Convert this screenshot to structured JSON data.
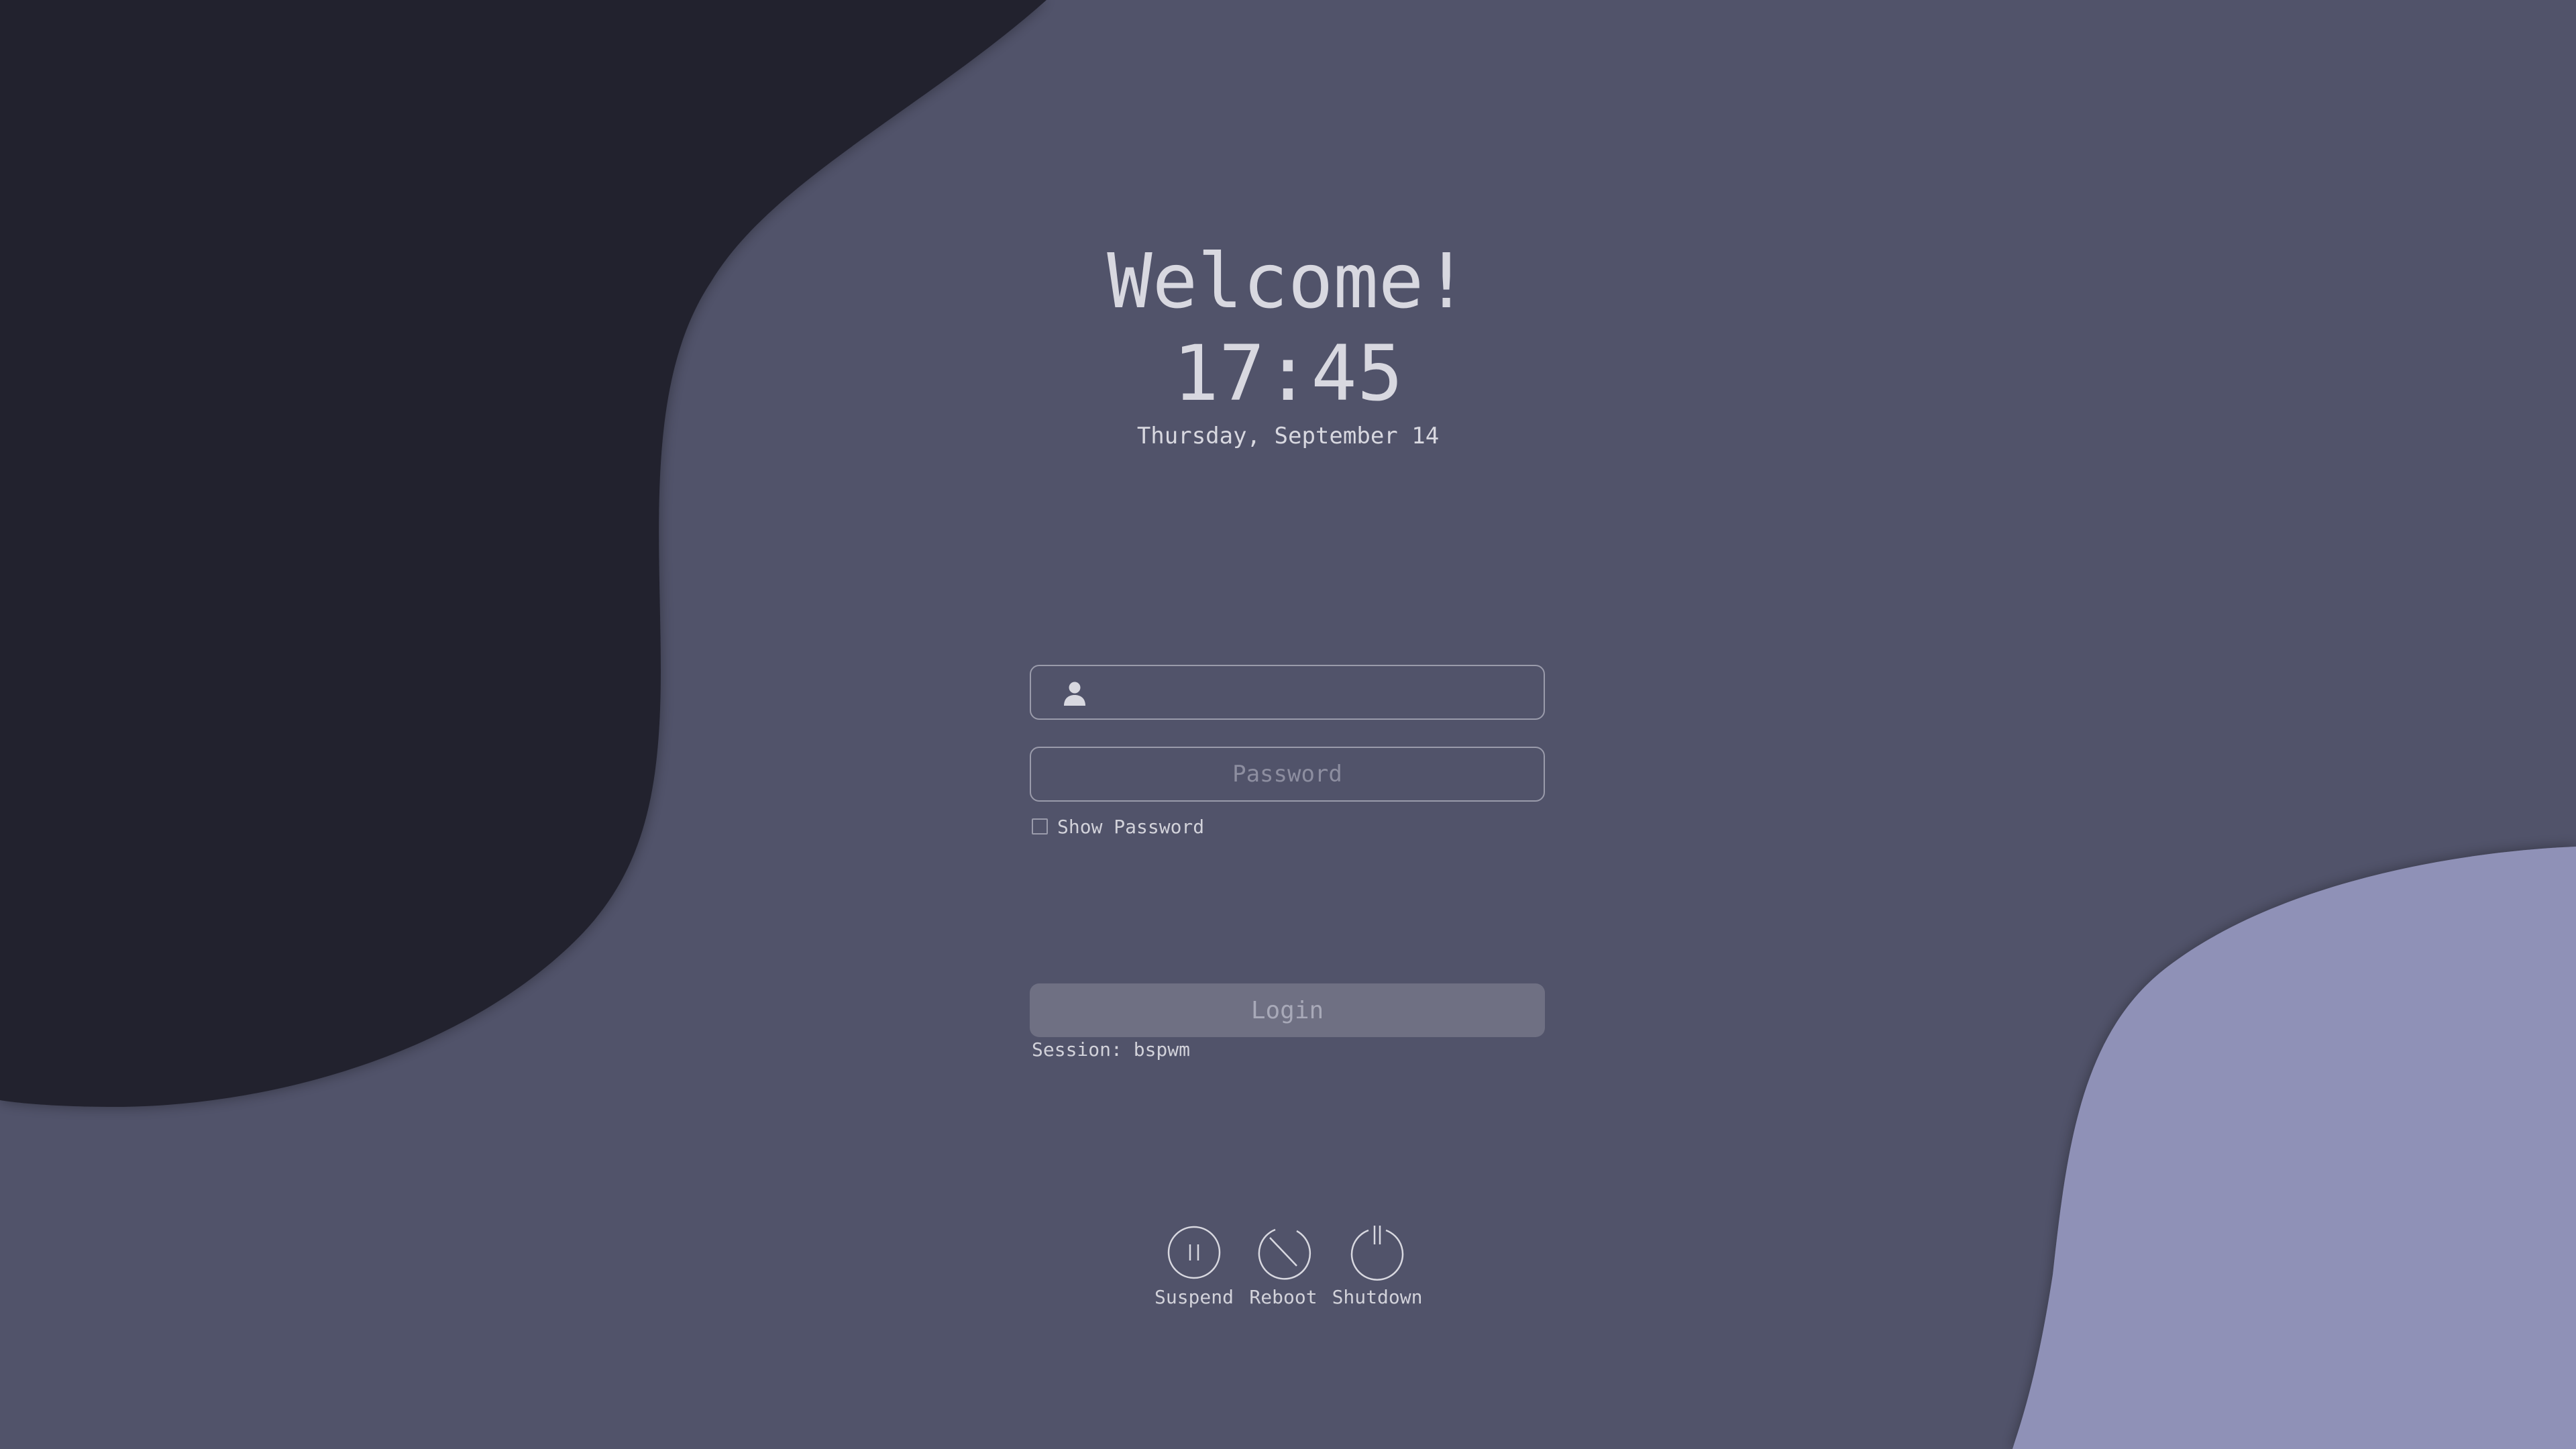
{
  "greeting": {
    "title": "Welcome!",
    "time": "17:45",
    "date": "Thursday, September 14"
  },
  "login_form": {
    "username_value": "",
    "password_placeholder": "Password",
    "show_password_label": "Show Password",
    "show_password_checked": false,
    "login_label": "Login",
    "session_label": "Session: bspwm"
  },
  "power": {
    "suspend_label": "Suspend",
    "reboot_label": "Reboot",
    "shutdown_label": "Shutdown"
  },
  "icons": {
    "user": "user-icon",
    "suspend": "pause-circle-icon",
    "reboot": "reboot-icon",
    "shutdown": "power-icon"
  },
  "colors": {
    "background": "#51536a",
    "dark_blob": "#23242f",
    "light_blob": "#8f91b7",
    "text": "#d8d8e0",
    "button": "#6f7083"
  }
}
